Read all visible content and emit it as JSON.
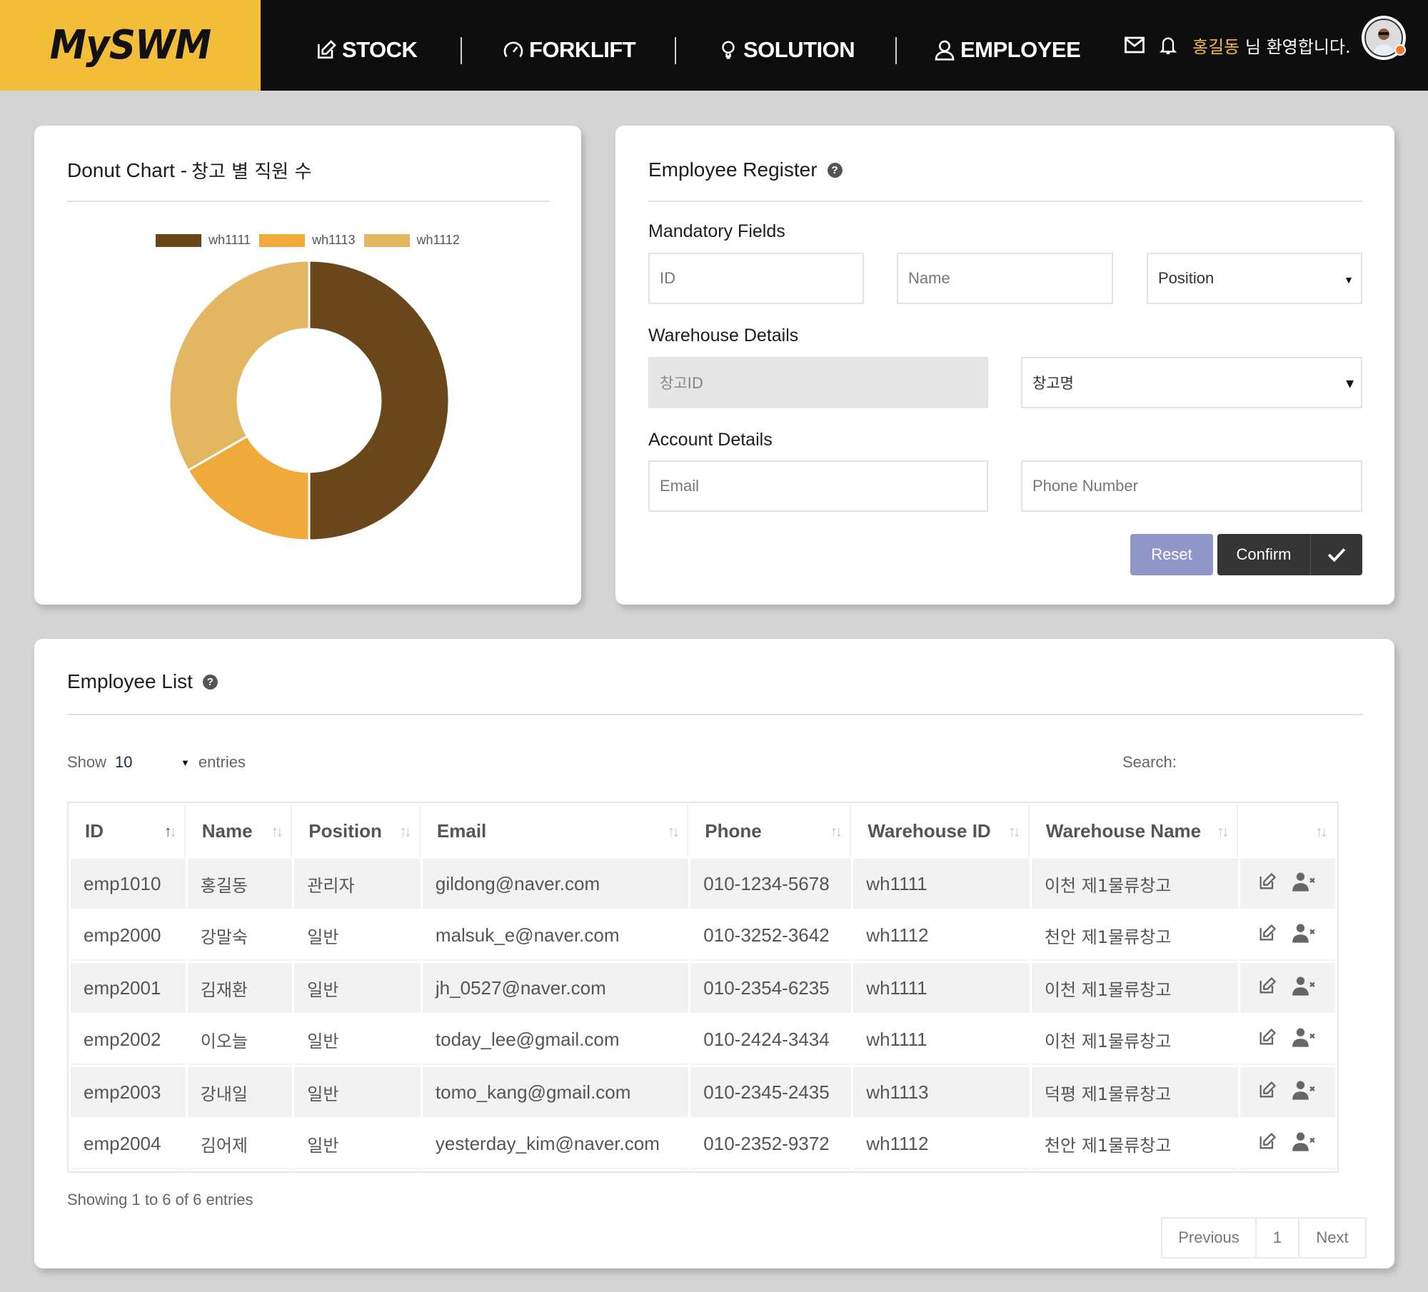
{
  "header": {
    "logo": "MySWM",
    "nav": [
      {
        "label": "STOCK",
        "icon": "edit-icon"
      },
      {
        "label": "FORKLIFT",
        "icon": "speedometer-icon"
      },
      {
        "label": "SOLUTION",
        "icon": "lightbulb-icon"
      },
      {
        "label": "EMPLOYEE",
        "icon": "user-icon"
      }
    ],
    "mail_icon": "mail-icon",
    "bell_icon": "bell-icon",
    "user_name": "홍길동",
    "welcome_suffix": " 님 환영합니다.",
    "status_color": "#f47a2a"
  },
  "donut_card": {
    "title_en": "Donut Chart -",
    "title_ko": "창고 별 직원 수"
  },
  "chart_data": {
    "type": "pie",
    "variant": "donut",
    "title": "Donut Chart - 창고 별 직원 수",
    "legend_position": "top",
    "labels": [
      "wh1111",
      "wh1113",
      "wh1112"
    ],
    "values": [
      3,
      1,
      2
    ],
    "colors": [
      "#69471a",
      "#f0aa39",
      "#e3b661"
    ]
  },
  "register": {
    "title": "Employee Register",
    "help_icon": "question-circle-icon",
    "mandatory_label": "Mandatory Fields",
    "id_placeholder": "ID",
    "name_placeholder": "Name",
    "position_select": "Position",
    "warehouse_label": "Warehouse Details",
    "warehouse_id_placeholder": "창고ID",
    "warehouse_name_select": "창고명",
    "account_label": "Account Details",
    "email_placeholder": "Email",
    "phone_placeholder": "Phone Number",
    "reset_label": "Reset",
    "confirm_label": "Confirm"
  },
  "list": {
    "title": "Employee List",
    "show_label": "Show",
    "page_length": "10",
    "entries_label": "entries",
    "search_label": "Search:",
    "columns": [
      "ID",
      "Name",
      "Position",
      "Email",
      "Phone",
      "Warehouse ID",
      "Warehouse Name",
      ""
    ],
    "rows": [
      {
        "id": "emp1010",
        "name": "홍길동",
        "position": "관리자",
        "email": "gildong@naver.com",
        "phone": "010-1234-5678",
        "wh_id": "wh1111",
        "wh_name": "이천 제1물류창고"
      },
      {
        "id": "emp2000",
        "name": "강말숙",
        "position": "일반",
        "email": "malsuk_e@naver.com",
        "phone": "010-3252-3642",
        "wh_id": "wh1112",
        "wh_name": "천안 제1물류창고"
      },
      {
        "id": "emp2001",
        "name": "김재환",
        "position": "일반",
        "email": "jh_0527@naver.com",
        "phone": "010-2354-6235",
        "wh_id": "wh1111",
        "wh_name": "이천 제1물류창고"
      },
      {
        "id": "emp2002",
        "name": "이오늘",
        "position": "일반",
        "email": "today_lee@gmail.com",
        "phone": "010-2424-3434",
        "wh_id": "wh1111",
        "wh_name": "이천 제1물류창고"
      },
      {
        "id": "emp2003",
        "name": "강내일",
        "position": "일반",
        "email": "tomo_kang@gmail.com",
        "phone": "010-2345-2435",
        "wh_id": "wh1113",
        "wh_name": "덕평 제1물류창고"
      },
      {
        "id": "emp2004",
        "name": "김어제",
        "position": "일반",
        "email": "yesterday_kim@naver.com",
        "phone": "010-2352-9372",
        "wh_id": "wh1112",
        "wh_name": "천안 제1물류창고"
      }
    ],
    "info": "Showing 1 to 6 of 6 entries",
    "pager": {
      "previous": "Previous",
      "page": "1",
      "next": "Next"
    }
  }
}
